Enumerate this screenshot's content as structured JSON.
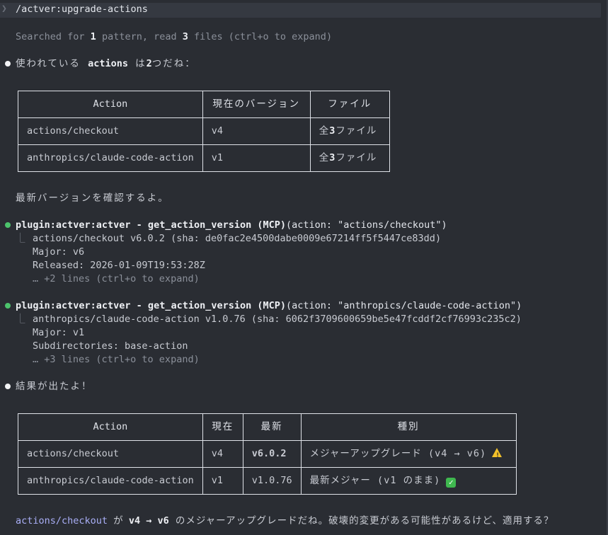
{
  "prompt": {
    "command": "/actver:upgrade-actions"
  },
  "search_summary": {
    "prefix": "Searched for ",
    "n1": "1",
    "mid": " pattern, read ",
    "n2": "3",
    "suffix": " files (ctrl+o to expand)"
  },
  "msg1": {
    "a": "使われている ",
    "b": "actions",
    "c": " は",
    "d": "2",
    "e": "つだね："
  },
  "table1": {
    "headers": [
      "Action",
      "現在のバージョン",
      "ファイル"
    ],
    "rows": [
      [
        "actions/checkout",
        "v4",
        "全",
        "3",
        "ファイル"
      ],
      [
        "anthropics/claude-code-action",
        "v1",
        "全",
        "3",
        "ファイル"
      ]
    ]
  },
  "msg2": "最新バージョンを確認するよ。",
  "tool1": {
    "name": "plugin:actver:actver - get_action_version (MCP)",
    "args": "(action: \"actions/checkout\")",
    "result": "actions/checkout v6.0.2 (sha: de0fac2e4500dabe0009e67214ff5f5447ce83dd)",
    "line2": "Major: v6",
    "line3": "Released: 2026-01-09T19:53:28Z",
    "more": "… +2 lines (ctrl+o to expand)"
  },
  "tool2": {
    "name": "plugin:actver:actver - get_action_version (MCP)",
    "args": "(action: \"anthropics/claude-code-action\")",
    "result": "anthropics/claude-code-action v1.0.76 (sha: 6062f3709600659be5e47fcddf2cf76993c235c2)",
    "line2": "Major: v1",
    "line3": "Subdirectories: base-action",
    "more": "… +3 lines (ctrl+o to expand)"
  },
  "msg3": "結果が出たよ！",
  "table2": {
    "headers": [
      "Action",
      "現在",
      "最新",
      "種別"
    ],
    "rows": [
      [
        "actions/checkout",
        "v4",
        "v6.0.2",
        "メジャーアップグレード (v4 → v6)"
      ],
      [
        "anthropics/claude-code-action",
        "v1",
        "v1.0.76",
        "最新メジャー (v1 のまま)"
      ]
    ]
  },
  "final": {
    "a": "actions/checkout",
    "b": " が ",
    "c": "v4 → v6",
    "d": " のメジャーアップグレードだね。破壊的変更がある可能性があるけど、適用する？"
  },
  "icons": {
    "warning": "warning-icon",
    "check": "check-mark-icon"
  },
  "colors": {
    "background": "#2a2d33",
    "link": "#a9aef6",
    "tool_bullet": "#4cc36c",
    "warning": "#f3c12a",
    "check": "#3fb84f"
  }
}
